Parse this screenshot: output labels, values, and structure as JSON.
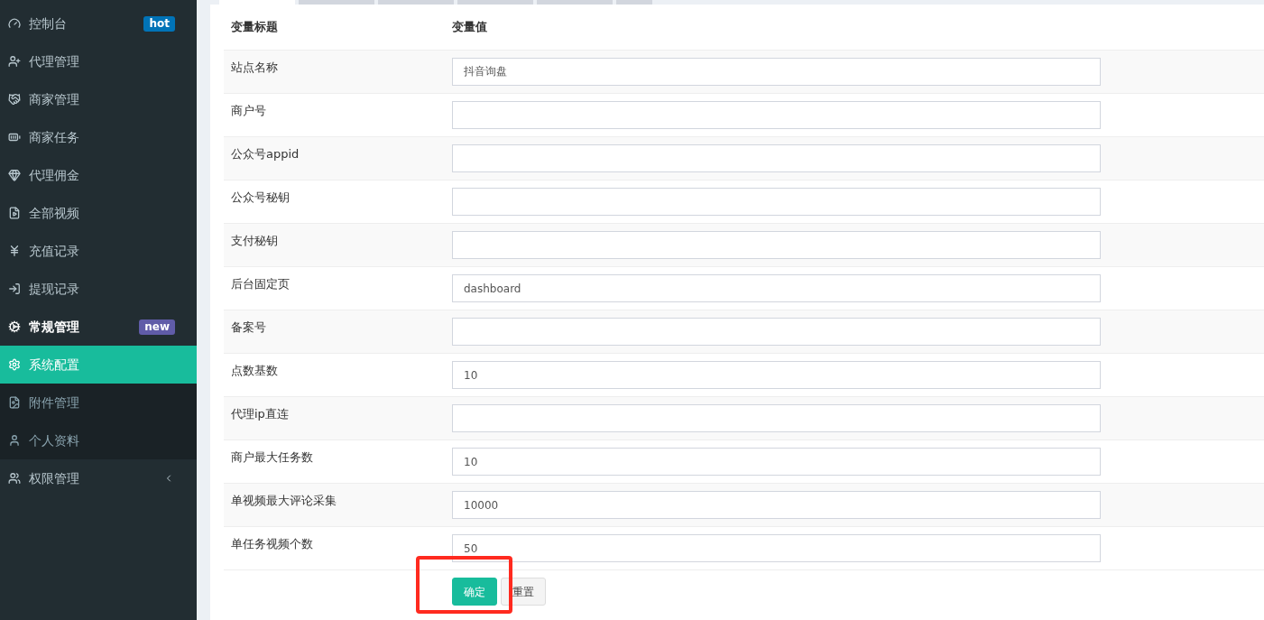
{
  "sidebar": {
    "items": [
      {
        "label": "控制台",
        "badge": {
          "text": "hot",
          "color": "#0073b7"
        }
      },
      {
        "label": "代理管理"
      },
      {
        "label": "商家管理"
      },
      {
        "label": "商家任务"
      },
      {
        "label": "代理佣金"
      },
      {
        "label": "全部视频"
      },
      {
        "label": "充值记录"
      },
      {
        "label": "提现记录"
      },
      {
        "label": "常规管理",
        "expanded": true,
        "badge": {
          "text": "new",
          "color": "#605ca8"
        },
        "children": [
          {
            "label": "系统配置",
            "selected": true
          },
          {
            "label": "附件管理",
            "selected": false
          },
          {
            "label": "个人资料",
            "selected": false
          }
        ]
      },
      {
        "label": "权限管理",
        "expanded": false
      }
    ]
  },
  "tabs": [
    {
      "selected": true
    },
    {
      "selected": false
    },
    {
      "selected": false
    },
    {
      "selected": false
    },
    {
      "selected": false
    },
    {
      "selected": false
    }
  ],
  "table": {
    "columns": [
      "变量标题",
      "变量值"
    ],
    "rows": [
      {
        "title": "站点名称",
        "value": "抖音询盘"
      },
      {
        "title": "商户号",
        "value": ""
      },
      {
        "title": "公众号appid",
        "value": ""
      },
      {
        "title": "公众号秘钥",
        "value": ""
      },
      {
        "title": "支付秘钥",
        "value": ""
      },
      {
        "title": "后台固定页",
        "value": "dashboard"
      },
      {
        "title": "备案号",
        "value": ""
      },
      {
        "title": "点数基数",
        "value": "10"
      },
      {
        "title": "代理ip直连",
        "value": ""
      },
      {
        "title": "商户最大任务数",
        "value": "10"
      },
      {
        "title": "单视频最大评论采集",
        "value": "10000"
      },
      {
        "title": "单任务视频个数",
        "value": "50"
      }
    ]
  },
  "buttons": [
    {
      "kind": "primary",
      "label": "确定"
    },
    {
      "kind": "default",
      "label": "重置"
    }
  ],
  "highlight_submit": true
}
